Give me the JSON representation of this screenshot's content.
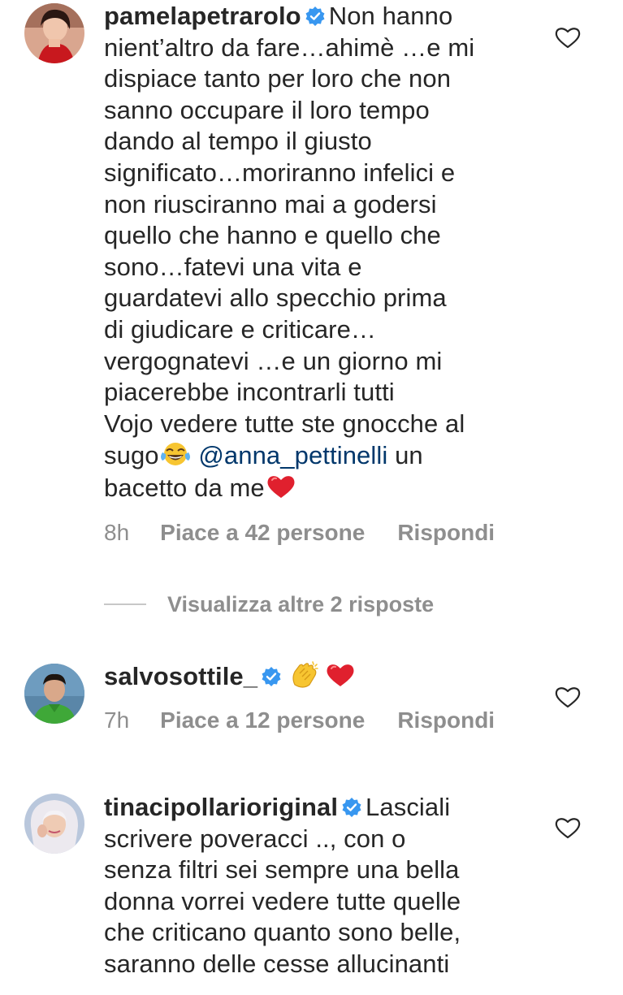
{
  "comments": [
    {
      "username": "pamelapetrarolo",
      "lines": [
        "Non hanno",
        "nient’altro da fare…ahimè …e mi",
        "dispiace tanto per loro che non",
        "sanno occupare il loro tempo",
        "dando al tempo il giusto",
        "significato…moriranno infelici e",
        "non riusciranno mai a godersi",
        "quello che hanno e quello che",
        "sono…fatevi una vita e",
        "guardatevi allo specchio prima",
        "di giudicare e criticare…",
        "vergognatevi …e un giorno mi",
        "piacerebbe incontrarli tutti"
      ],
      "extra": {
        "line1": "Vojo vedere tutte ste gnocche al",
        "line2_start": "sugo",
        "emoji1": "face-with-tears-of-joy",
        "mention": "@anna_pettinelli",
        "line2_end": " un",
        "line3": "bacetto da me",
        "emoji2": "red-heart"
      },
      "time": "8h",
      "likes": "Piace a 42 persone",
      "reply": "Rispondi"
    },
    {
      "username": "salvosottile_",
      "emojis": [
        "clapping-hands",
        "red-heart"
      ],
      "time": "7h",
      "likes": "Piace a 12 persone",
      "reply": "Rispondi"
    },
    {
      "username": "tinacipollarioriginal",
      "lines": [
        "Lasciali",
        "scrivere poveracci .., con o",
        "senza filtri  sei sempre una bella",
        "donna  vorrei vedere tutte quelle",
        "che criticano quanto sono belle,",
        "saranno delle cesse allucinanti"
      ]
    }
  ],
  "view_replies": "Visualizza altre 2 risposte",
  "colors": {
    "text": "#262626",
    "meta": "#8e8e8e",
    "verified": "#3897f0",
    "mention": "#00376b",
    "heart": "#e0202e"
  },
  "icons": [
    "verified-badge-icon",
    "heart-outline-icon",
    "face-with-tears-of-joy",
    "clapping-hands",
    "red-heart"
  ]
}
